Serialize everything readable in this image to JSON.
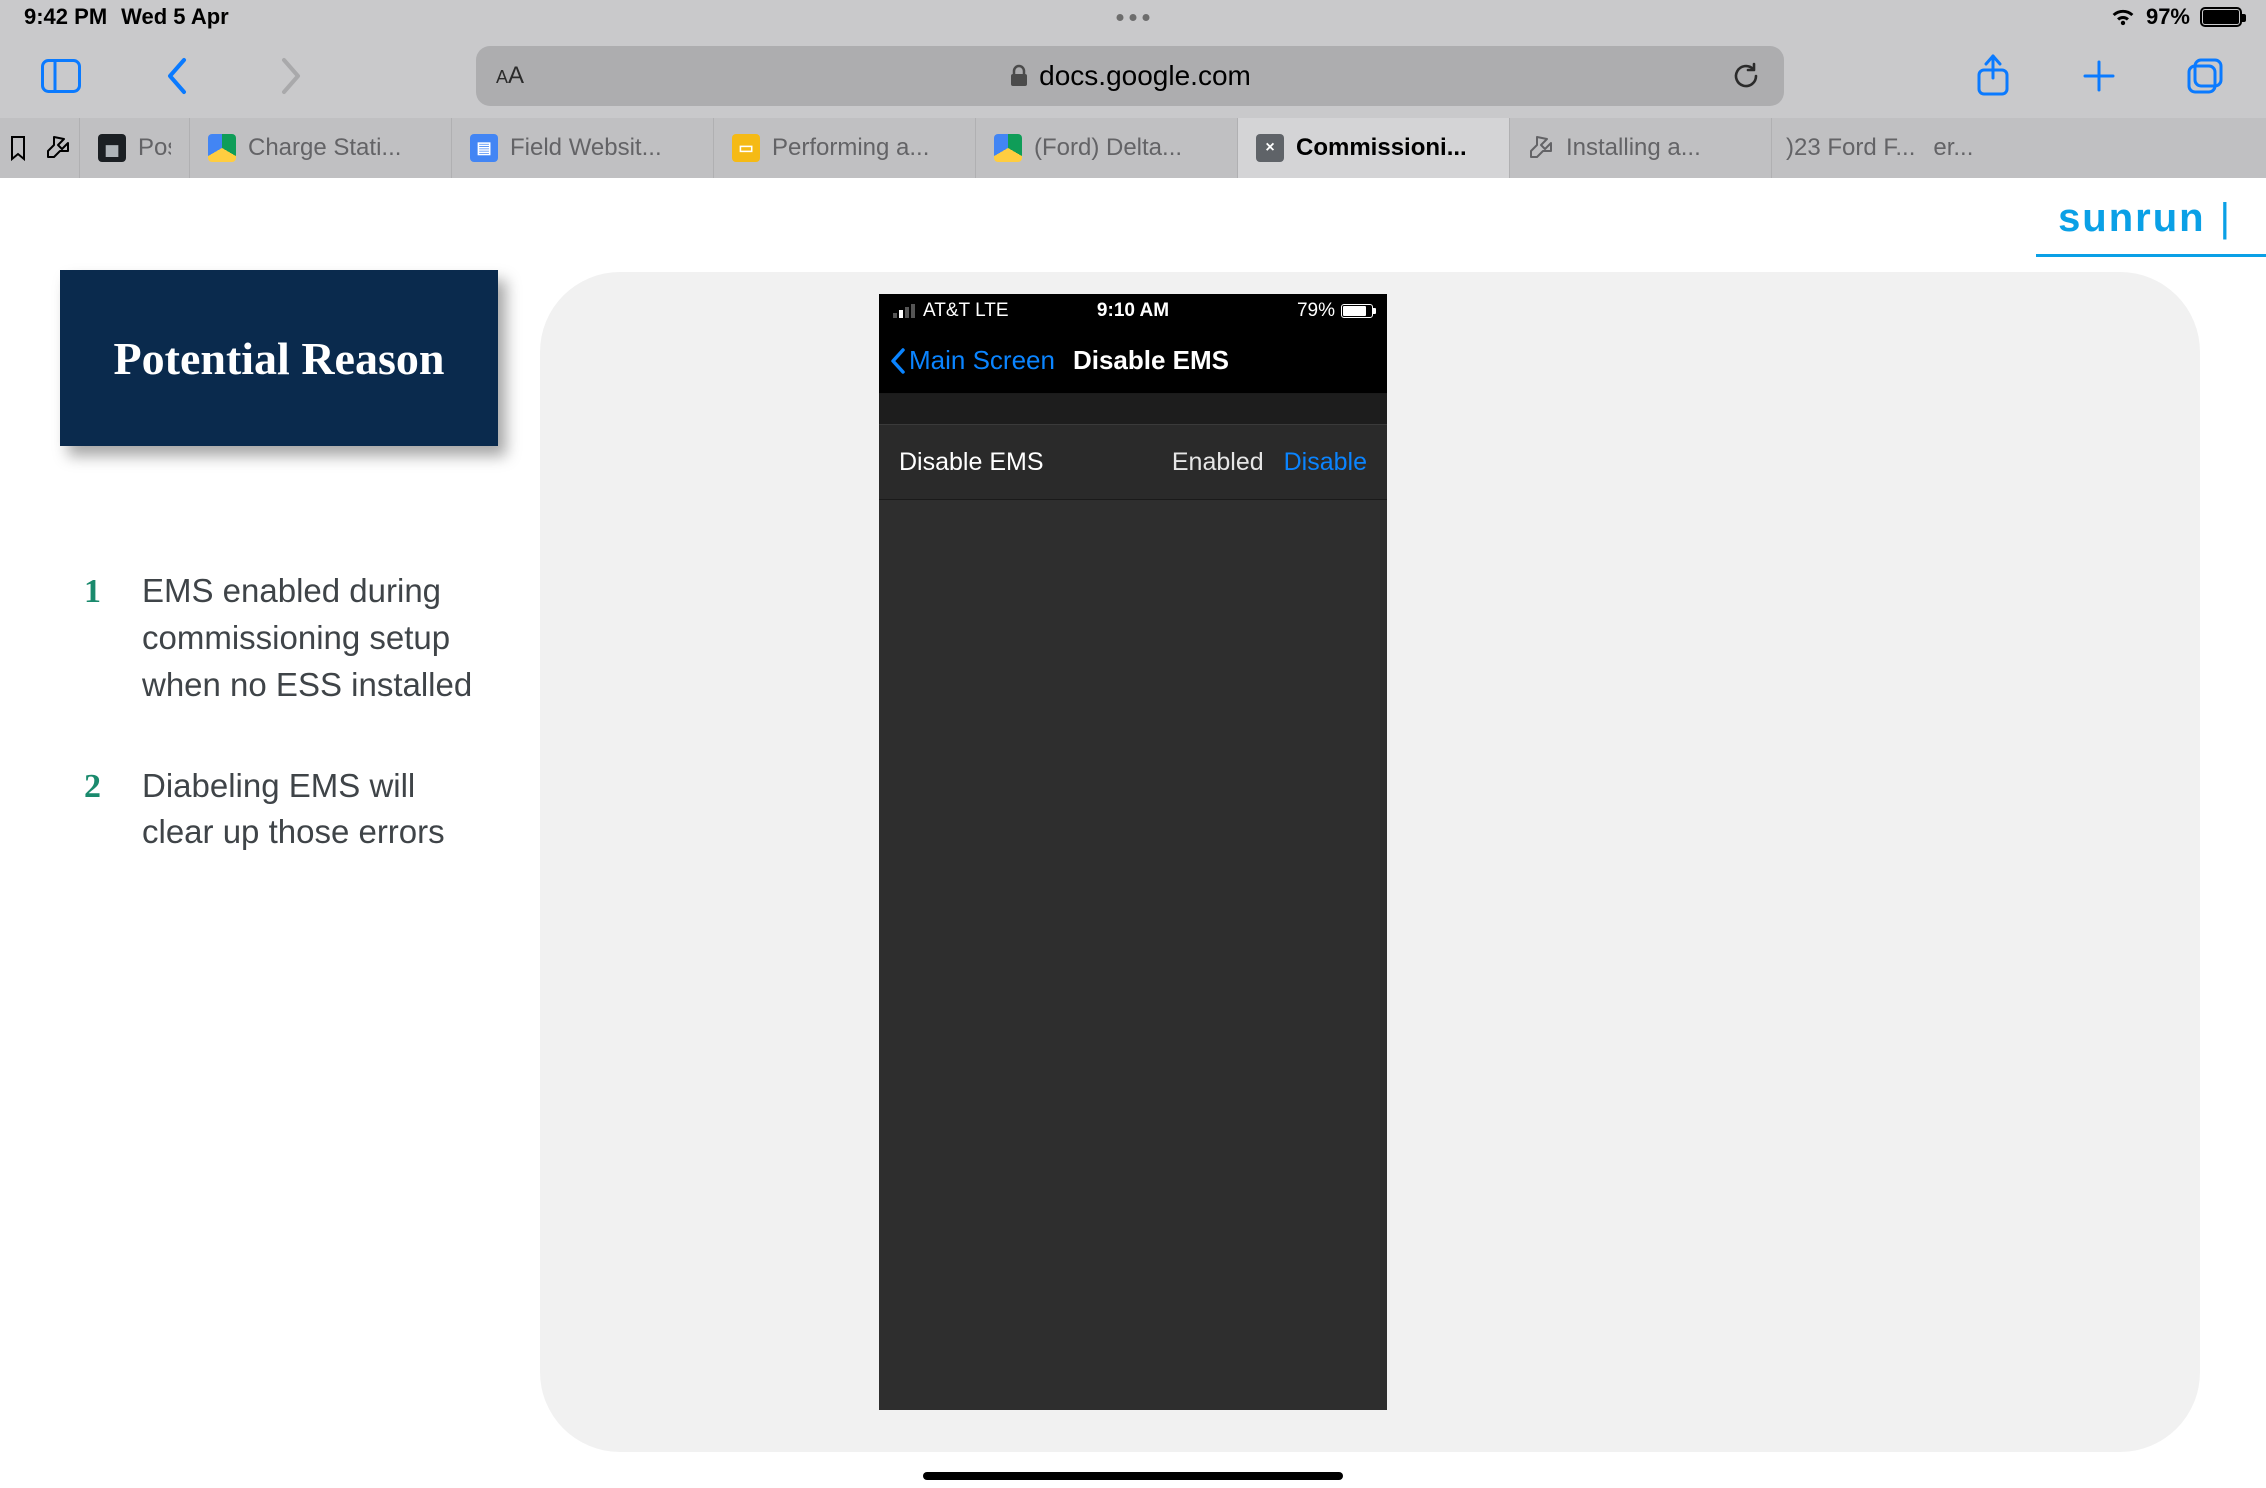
{
  "ipad_status": {
    "time": "9:42 PM",
    "date": "Wed 5 Apr",
    "battery_percent": "97%"
  },
  "safari": {
    "url_display": "docs.google.com",
    "tabs": [
      {
        "label": "Possible to c"
      },
      {
        "label": "Charge Stati..."
      },
      {
        "label": "Field Websit..."
      },
      {
        "label": "Performing a..."
      },
      {
        "label": "(Ford) Delta..."
      },
      {
        "label": "Commissioni..."
      },
      {
        "label": "Installing a..."
      }
    ],
    "overflow_a": ")23 Ford F...",
    "overflow_b": "er..."
  },
  "slide": {
    "brand": "sunrun",
    "title": "Potential Reason",
    "items": [
      {
        "num": "1",
        "text": "EMS enabled during commissioning setup when no ESS installed"
      },
      {
        "num": "2",
        "text": "Diabeling EMS will clear up those errors"
      }
    ]
  },
  "phone": {
    "carrier": "AT&T  LTE",
    "time": "9:10 AM",
    "battery": "79%",
    "back_label": "Main Screen",
    "nav_title": "Disable EMS",
    "row_label": "Disable EMS",
    "row_status": "Enabled",
    "row_action": "Disable"
  }
}
